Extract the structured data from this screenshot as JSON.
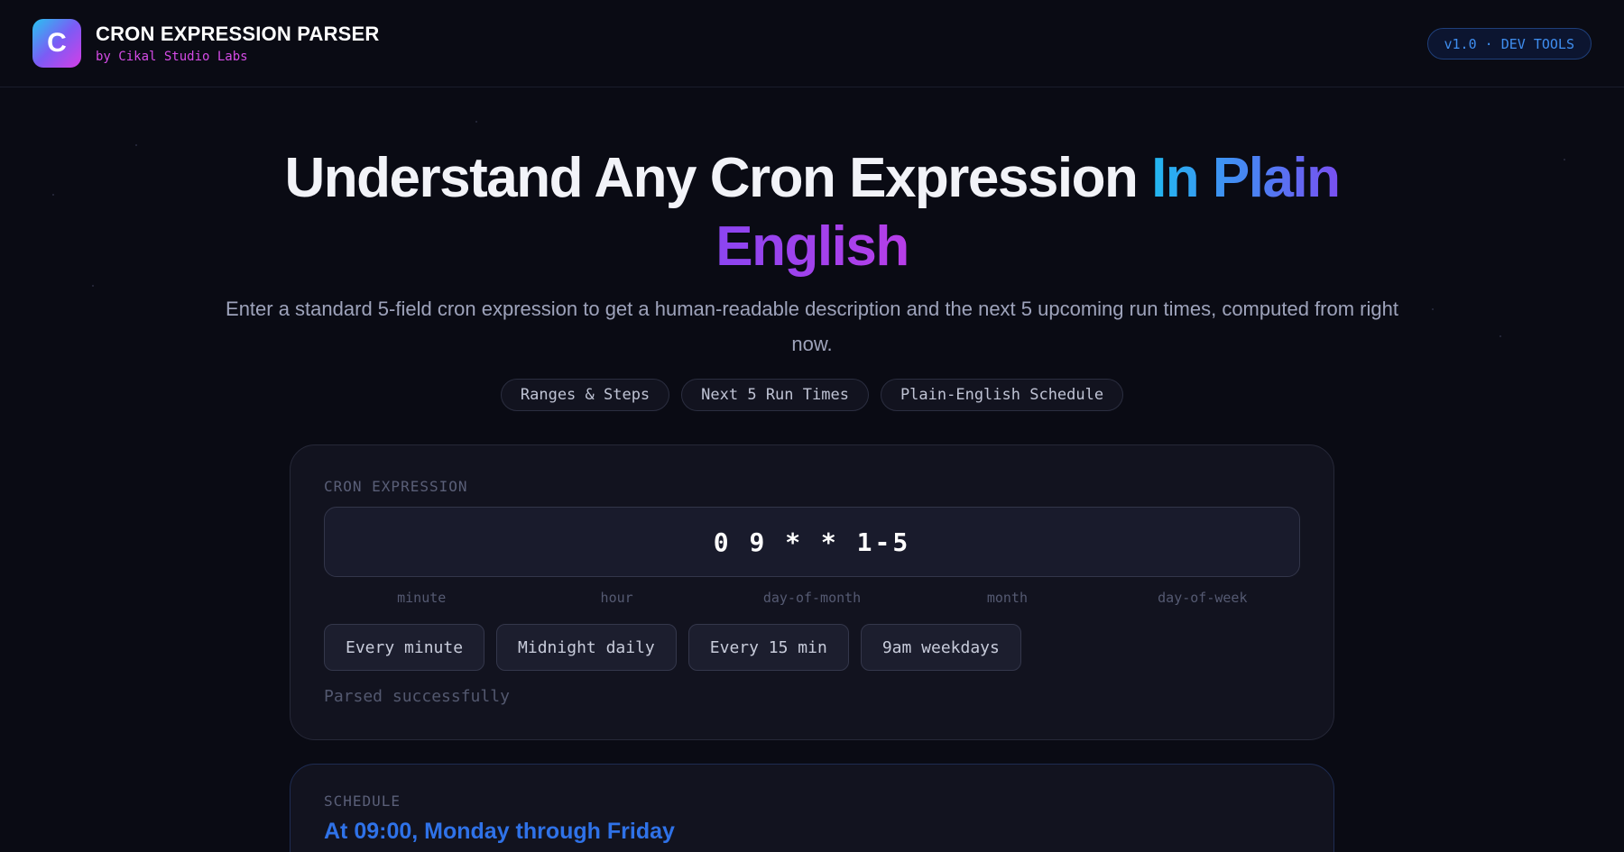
{
  "header": {
    "logo_letter": "C",
    "title": "CRON EXPRESSION PARSER",
    "subtitle": "by Cikal Studio Labs",
    "version_badge": "v1.0 · DEV TOOLS"
  },
  "hero": {
    "title_main": "Understand Any Cron Expression ",
    "title_accent_1": "In Plain",
    "title_accent_2": "English",
    "subtitle": "Enter a standard 5-field cron expression to get a human-readable description and the next 5 upcoming run times, computed from right now.",
    "feature_chips": [
      "Ranges & Steps",
      "Next 5 Run Times",
      "Plain-English Schedule"
    ]
  },
  "input_card": {
    "label": "CRON EXPRESSION",
    "expression": "0 9 * * 1-5",
    "fields": [
      "minute",
      "hour",
      "day-of-month",
      "month",
      "day-of-week"
    ],
    "presets": [
      "Every minute",
      "Midnight daily",
      "Every 15 min",
      "9am weekdays"
    ],
    "status": "Parsed successfully"
  },
  "schedule_card": {
    "label": "SCHEDULE",
    "description": "At 09:00, Monday through Friday"
  },
  "colors": {
    "background": "#0a0b14",
    "card": "#12131f",
    "accent_blue": "#2f72e8",
    "accent_magenta": "#d54be6"
  }
}
